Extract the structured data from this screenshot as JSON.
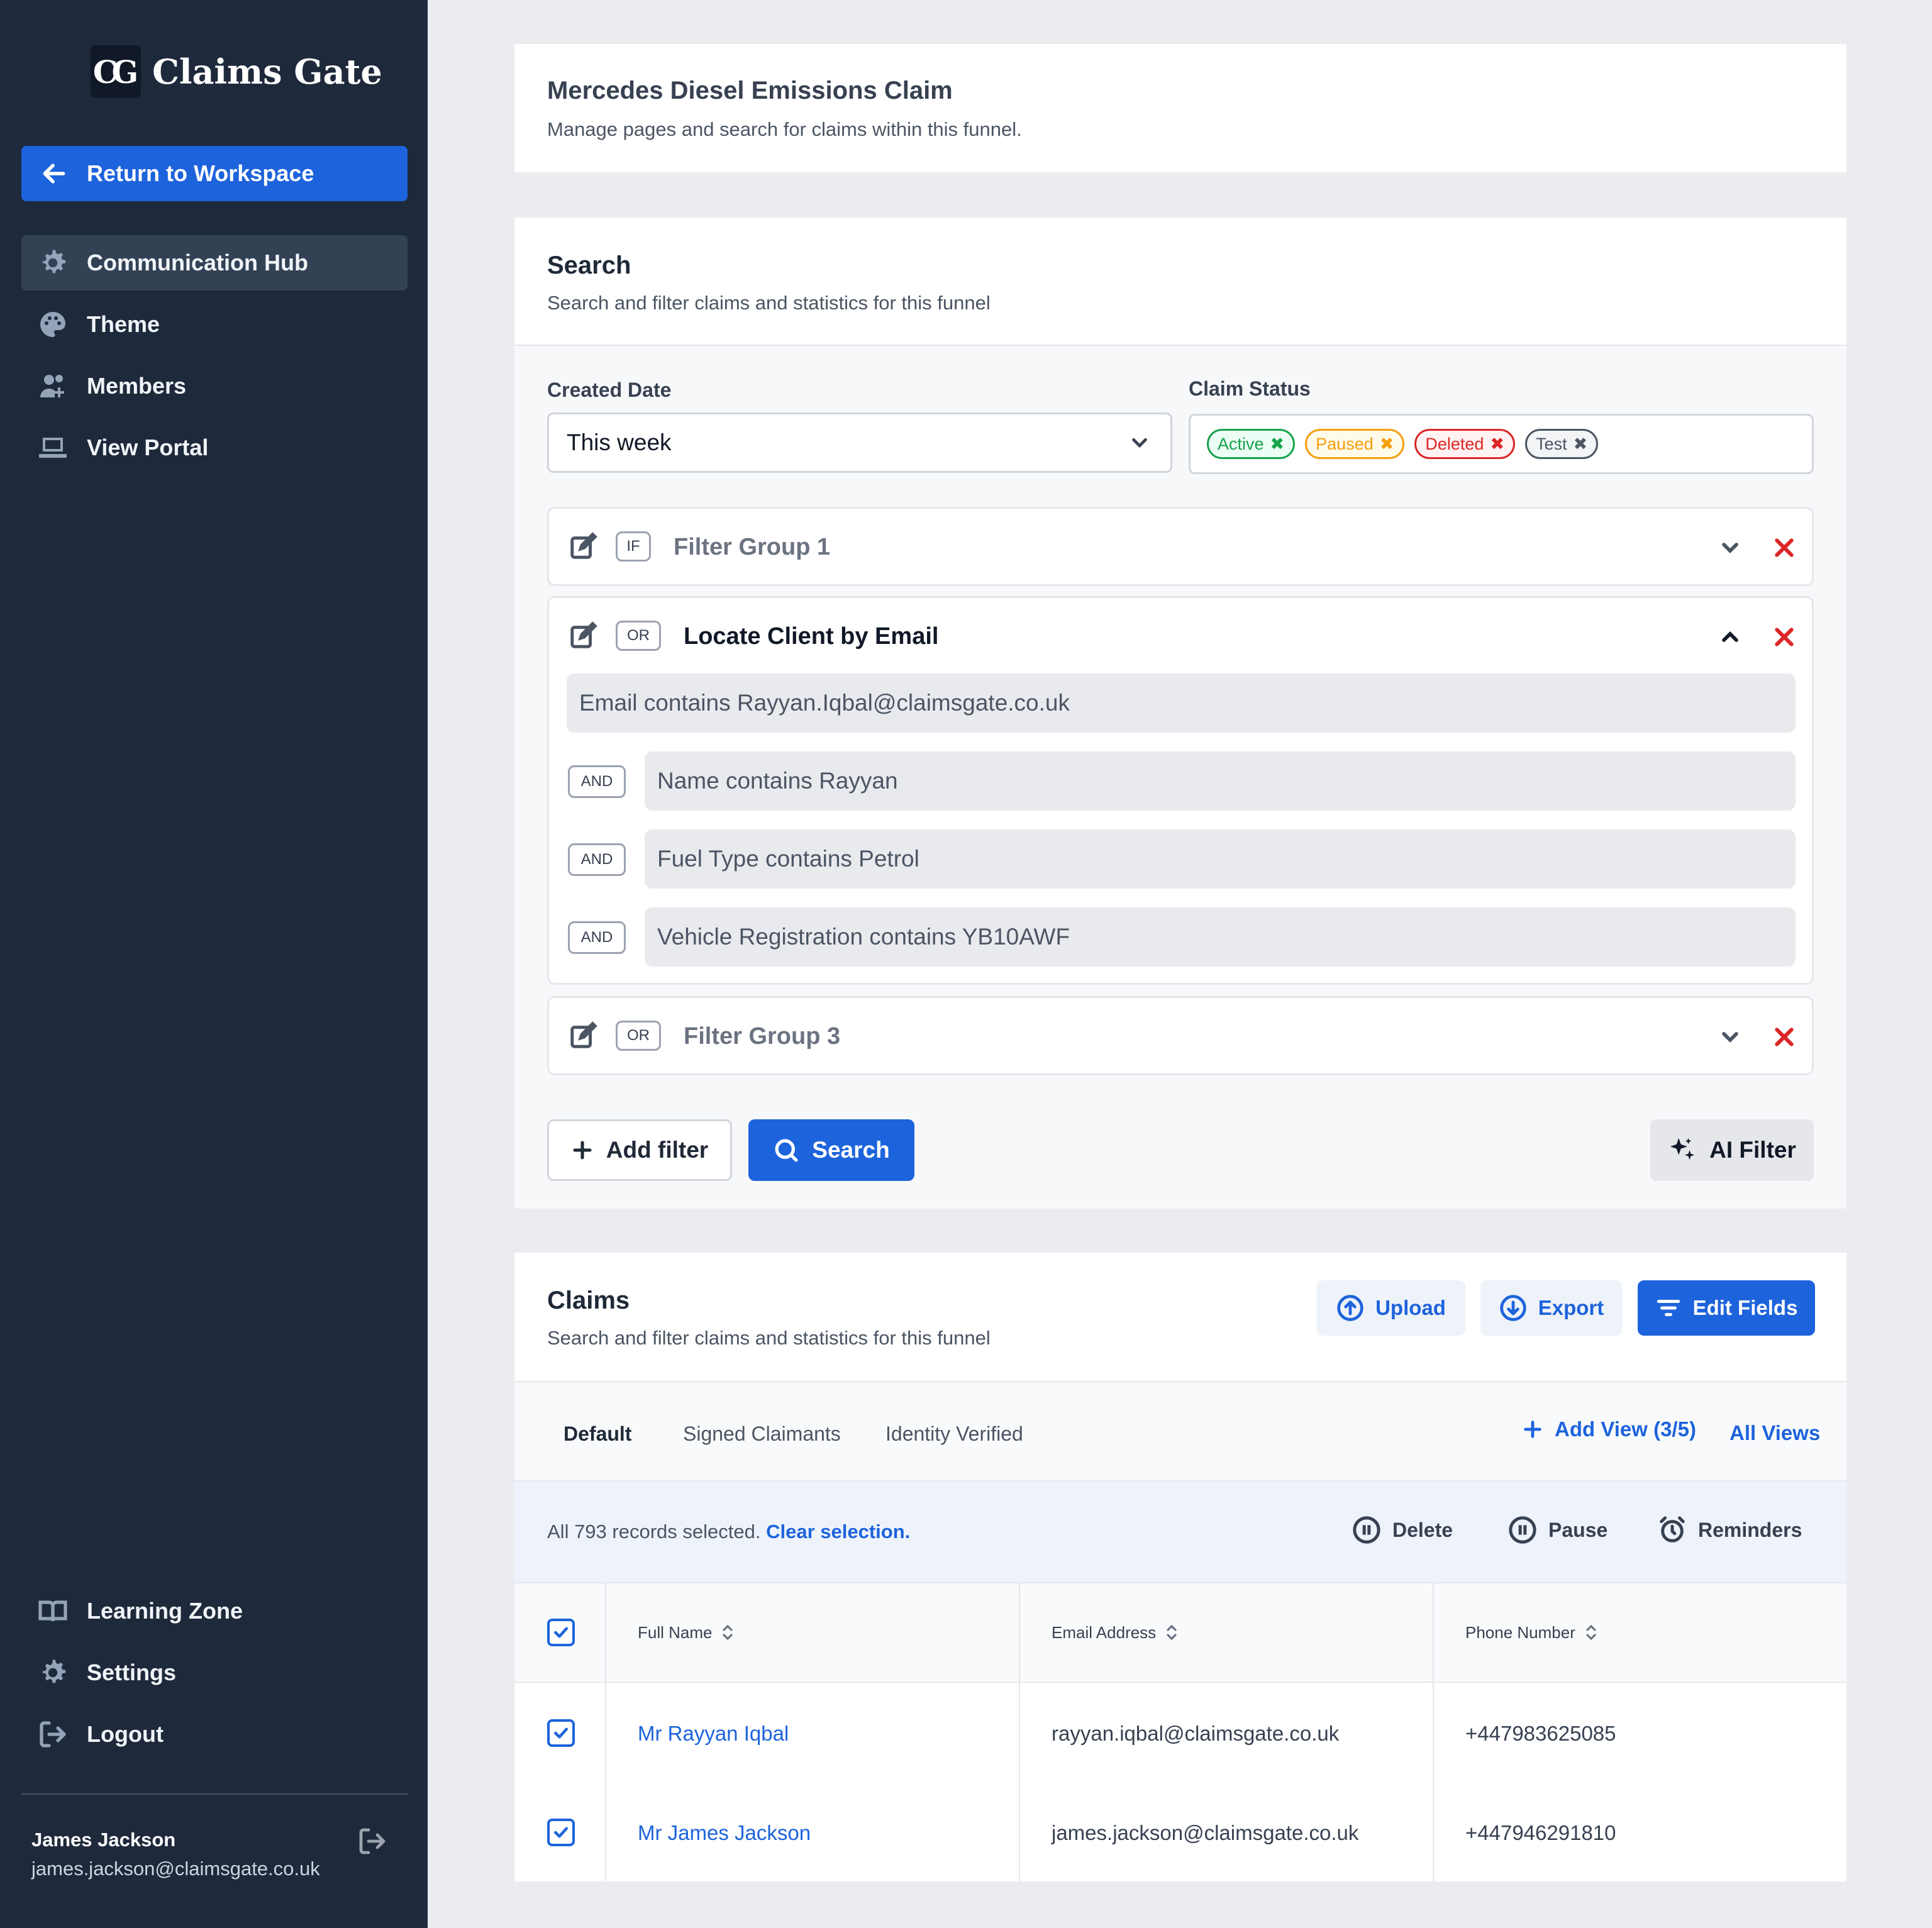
{
  "sidebar": {
    "logo_mark": "CG",
    "logo_text": "Claims Gate",
    "return_label": "Return to Workspace",
    "items": [
      {
        "label": "Communication Hub",
        "icon": "gear-icon"
      },
      {
        "label": "Theme",
        "icon": "palette-icon"
      },
      {
        "label": "Members",
        "icon": "user-plus-icon"
      },
      {
        "label": "View Portal",
        "icon": "laptop-icon"
      }
    ],
    "bottom_items": [
      {
        "label": "Learning Zone",
        "icon": "book-icon"
      },
      {
        "label": "Settings",
        "icon": "gear-icon"
      },
      {
        "label": "Logout",
        "icon": "logout-icon"
      }
    ],
    "user": {
      "name": "James Jackson",
      "email": "james.jackson@claimsgate.co.uk"
    }
  },
  "header": {
    "title": "Mercedes Diesel Emissions Claim",
    "subtitle": "Manage pages and search for claims within this funnel."
  },
  "search": {
    "title": "Search",
    "subtitle": "Search and filter claims and statistics for this funnel",
    "created_date_label": "Created Date",
    "created_date_value": "This week",
    "claim_status_label": "Claim Status",
    "statuses": [
      {
        "label": "Active",
        "color": "#16a34a",
        "bg": "#ecfdf5"
      },
      {
        "label": "Paused",
        "color": "#f59e0b",
        "bg": "#fffbeb"
      },
      {
        "label": "Deleted",
        "color": "#dc2626",
        "bg": "#fef2f2"
      },
      {
        "label": "Test",
        "color": "#4b5563",
        "bg": "#f3f4f6"
      }
    ],
    "groups": [
      {
        "tag": "IF",
        "title": "Filter Group 1"
      },
      {
        "tag": "OR",
        "title": "Locate Client by Email",
        "first_condition": "Email contains Rayyan.Iqbal@claimsgate.co.uk",
        "conditions": [
          {
            "op": "AND",
            "text": "Name contains Rayyan"
          },
          {
            "op": "AND",
            "text": "Fuel Type contains Petrol"
          },
          {
            "op": "AND",
            "text": "Vehicle Registration contains YB10AWF"
          }
        ]
      },
      {
        "tag": "OR",
        "title": "Filter Group 3"
      }
    ],
    "add_filter_label": "Add filter",
    "search_label": "Search",
    "ai_filter_label": "AI Filter"
  },
  "claims": {
    "title": "Claims",
    "subtitle": "Search and filter claims and statistics for this funnel",
    "upload_label": "Upload",
    "export_label": "Export",
    "edit_fields_label": "Edit Fields",
    "tabs": [
      "Default",
      "Signed Claimants",
      "Identity Verified"
    ],
    "add_view_label": "Add View (3/5)",
    "all_views_label": "All Views",
    "selection_text": "All 793 records selected.",
    "clear_selection_label": "Clear selection.",
    "delete_label": "Delete",
    "pause_label": "Pause",
    "reminders_label": "Reminders",
    "columns": [
      "Full Name",
      "Email Address",
      "Phone Number"
    ],
    "rows": [
      {
        "name": "Mr Rayyan Iqbal",
        "email": "rayyan.iqbal@claimsgate.co.uk",
        "phone": "+447983625085"
      },
      {
        "name": "Mr James Jackson",
        "email": "james.jackson@claimsgate.co.uk",
        "phone": "+447946291810"
      }
    ]
  },
  "colors": {
    "accent": "#1d63dc",
    "sidebar": "#1e293b",
    "danger": "#dc2626"
  }
}
